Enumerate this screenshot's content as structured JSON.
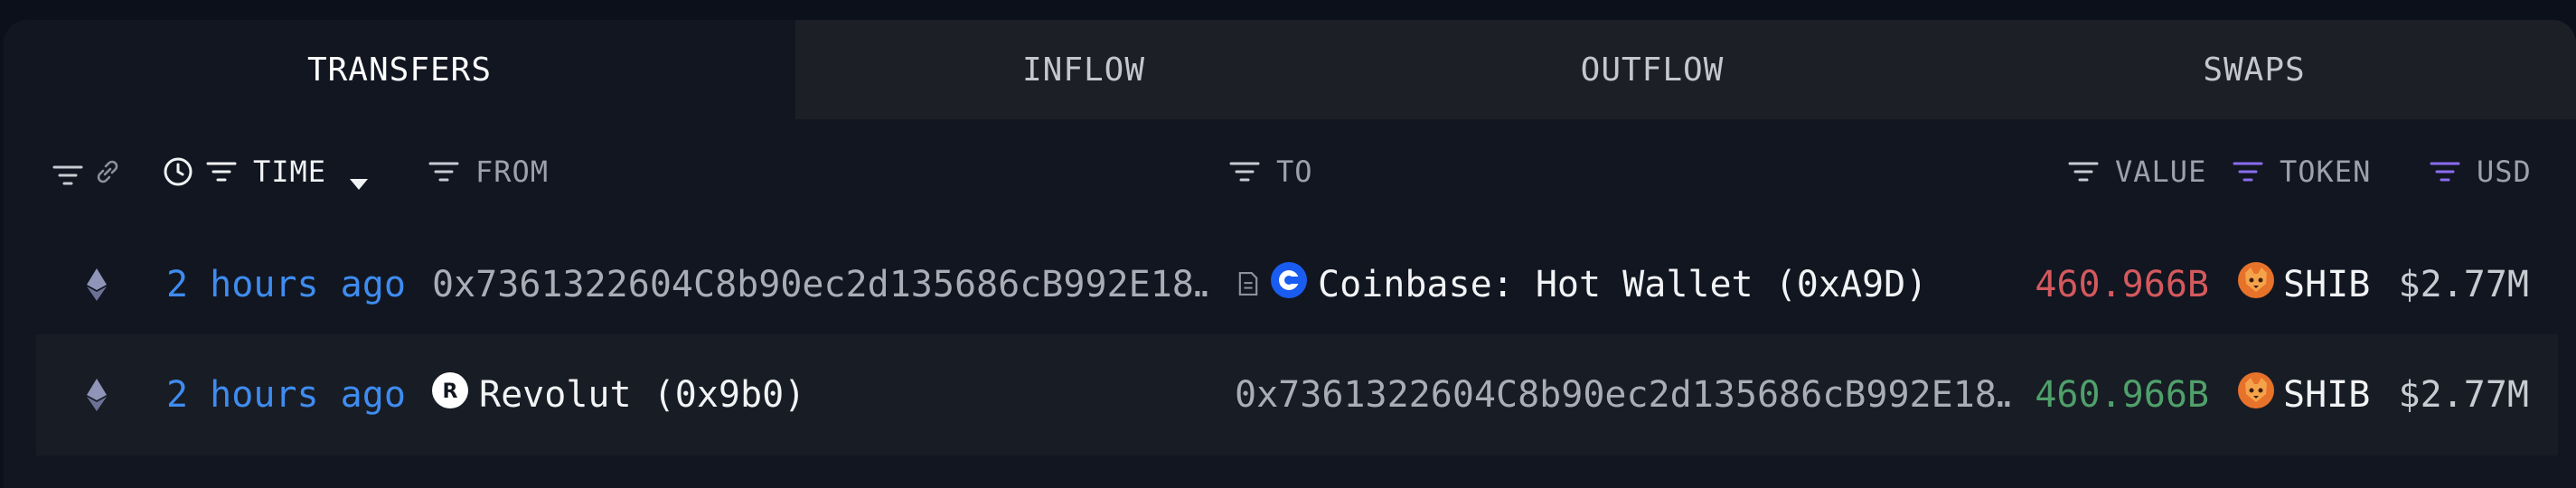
{
  "tabs": [
    {
      "label": "TRANSFERS",
      "active": true
    },
    {
      "label": "INFLOW",
      "active": false
    },
    {
      "label": "OUTFLOW",
      "active": false
    },
    {
      "label": "SWAPS",
      "active": false
    }
  ],
  "columns": {
    "time": "TIME",
    "from": "FROM",
    "to": "TO",
    "value": "VALUE",
    "token": "TOKEN",
    "usd": "USD"
  },
  "rows": [
    {
      "time": "2 hours ago",
      "from": "0x7361322604C8b90ec2d135686cB992E18…",
      "to": "Coinbase: Hot Wallet (0xA9D)",
      "value": "460.966B",
      "token": "SHIB",
      "usd": "$2.77M"
    },
    {
      "time": "2 hours ago",
      "from": "Revolut (0x9b0)",
      "to": "0x7361322604C8b90ec2d135686cB992E18…",
      "value": "460.966B",
      "token": "SHIB",
      "usd": "$2.77M"
    }
  ],
  "colors": {
    "outflow": "#d4595d",
    "inflow": "#4fa06a",
    "link": "#3f8cf0",
    "token_filter": "#8b6cf0"
  }
}
